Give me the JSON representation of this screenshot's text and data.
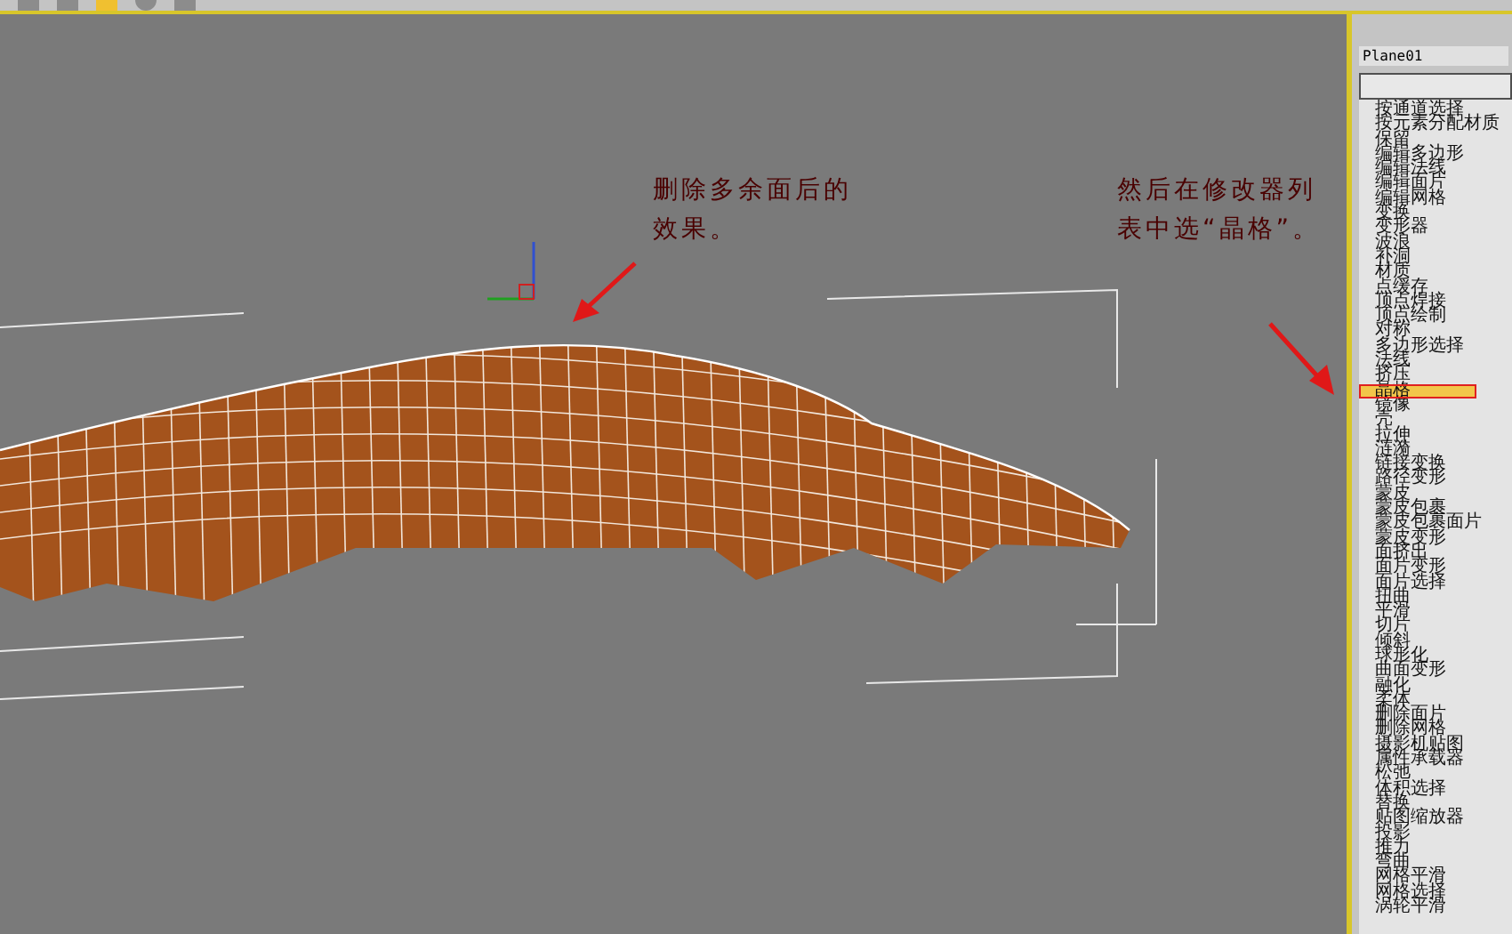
{
  "viewport": {
    "annotations": [
      {
        "text": "删除多余面后的效果。"
      },
      {
        "text": "然后在修改器列表中选“晶格”。"
      }
    ]
  },
  "modifier_panel": {
    "object_name": "Plane01",
    "modifiers": [
      {
        "label": "按通道选择",
        "selected": false
      },
      {
        "label": "按元素分配材质",
        "selected": false
      },
      {
        "label": "保留",
        "selected": false
      },
      {
        "label": "编辑多边形",
        "selected": false
      },
      {
        "label": "编辑法线",
        "selected": false
      },
      {
        "label": "编辑面片",
        "selected": false
      },
      {
        "label": "编辑网格",
        "selected": false
      },
      {
        "label": "变换",
        "selected": false
      },
      {
        "label": "变形器",
        "selected": false
      },
      {
        "label": "波浪",
        "selected": false
      },
      {
        "label": "补洞",
        "selected": false
      },
      {
        "label": "材质",
        "selected": false
      },
      {
        "label": "点缓存",
        "selected": false
      },
      {
        "label": "顶点焊接",
        "selected": false
      },
      {
        "label": "顶点绘制",
        "selected": false
      },
      {
        "label": "对称",
        "selected": false
      },
      {
        "label": "多边形选择",
        "selected": false
      },
      {
        "label": "法线",
        "selected": false
      },
      {
        "label": "挤压",
        "selected": false
      },
      {
        "label": "晶格",
        "selected": true
      },
      {
        "label": "镜像",
        "selected": false
      },
      {
        "label": "壳",
        "selected": false
      },
      {
        "label": "拉伸",
        "selected": false
      },
      {
        "label": "涟漪",
        "selected": false
      },
      {
        "label": "链接变换",
        "selected": false
      },
      {
        "label": "路径变形",
        "selected": false
      },
      {
        "label": "蒙皮",
        "selected": false
      },
      {
        "label": "蒙皮包裹",
        "selected": false
      },
      {
        "label": "蒙皮包裹面片",
        "selected": false
      },
      {
        "label": "蒙皮变形",
        "selected": false
      },
      {
        "label": "面挤出",
        "selected": false
      },
      {
        "label": "面片变形",
        "selected": false
      },
      {
        "label": "面片选择",
        "selected": false
      },
      {
        "label": "扭曲",
        "selected": false
      },
      {
        "label": "平滑",
        "selected": false
      },
      {
        "label": "切片",
        "selected": false
      },
      {
        "label": "倾斜",
        "selected": false
      },
      {
        "label": "球形化",
        "selected": false
      },
      {
        "label": "曲面变形",
        "selected": false
      },
      {
        "label": "融化",
        "selected": false
      },
      {
        "label": "柔体",
        "selected": false
      },
      {
        "label": "删除面片",
        "selected": false
      },
      {
        "label": "删除网格",
        "selected": false
      },
      {
        "label": "摄影机贴图",
        "selected": false
      },
      {
        "label": "属性承载器",
        "selected": false
      },
      {
        "label": "松弛",
        "selected": false
      },
      {
        "label": "体积选择",
        "selected": false
      },
      {
        "label": "替换",
        "selected": false
      },
      {
        "label": "贴图缩放器",
        "selected": false
      },
      {
        "label": "投影",
        "selected": false
      },
      {
        "label": "推力",
        "selected": false
      },
      {
        "label": "弯曲",
        "selected": false
      },
      {
        "label": "网格平滑",
        "selected": false
      },
      {
        "label": "网格选择",
        "selected": false
      },
      {
        "label": "涡轮平滑",
        "selected": false
      }
    ]
  }
}
